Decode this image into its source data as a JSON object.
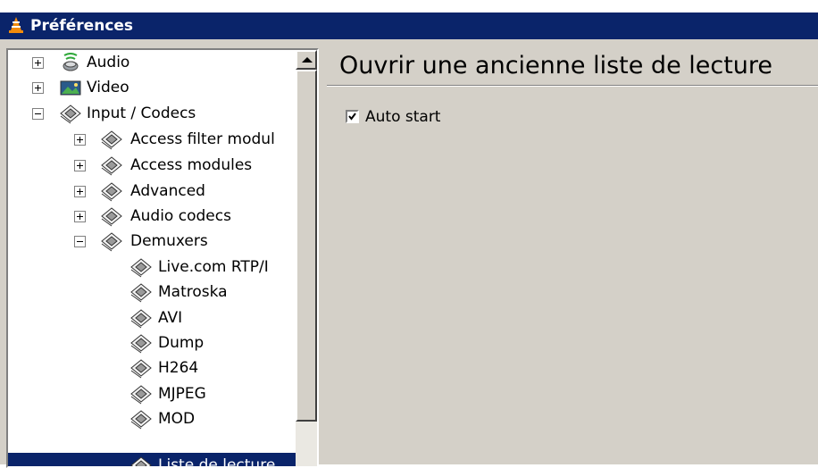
{
  "window": {
    "title": "Préférences"
  },
  "tree": {
    "items": [
      {
        "label": "Audio",
        "expander": "plus",
        "icon": "speaker-icon"
      },
      {
        "label": "Video",
        "expander": "plus",
        "icon": "video-icon"
      },
      {
        "label": "Input / Codecs",
        "expander": "minus",
        "icon": "codec-icon"
      },
      {
        "label": "Access filter modul",
        "expander": "plus",
        "icon": "codec-icon"
      },
      {
        "label": "Access modules",
        "expander": "plus",
        "icon": "codec-icon"
      },
      {
        "label": "Advanced",
        "expander": "plus",
        "icon": "codec-icon"
      },
      {
        "label": "Audio codecs",
        "expander": "plus",
        "icon": "codec-icon"
      },
      {
        "label": "Demuxers",
        "expander": "minus",
        "icon": "codec-icon"
      },
      {
        "label": "Live.com RTP/I",
        "icon": "codec-icon"
      },
      {
        "label": "Matroska",
        "icon": "codec-icon"
      },
      {
        "label": "AVI",
        "icon": "codec-icon"
      },
      {
        "label": "Dump",
        "icon": "codec-icon"
      },
      {
        "label": "H264",
        "icon": "codec-icon"
      },
      {
        "label": "MJPEG",
        "icon": "codec-icon"
      },
      {
        "label": "MOD",
        "icon": "codec-icon"
      },
      {
        "label": "Liste de lecture",
        "icon": "codec-icon",
        "selected": true
      }
    ]
  },
  "panel": {
    "title": "Ouvrir une ancienne liste de lecture",
    "options": [
      {
        "label": "Auto start",
        "checked": true
      }
    ]
  },
  "colors": {
    "titlebar": "#0a246a",
    "selection": "#0a246a",
    "face": "#d4d0c8"
  }
}
